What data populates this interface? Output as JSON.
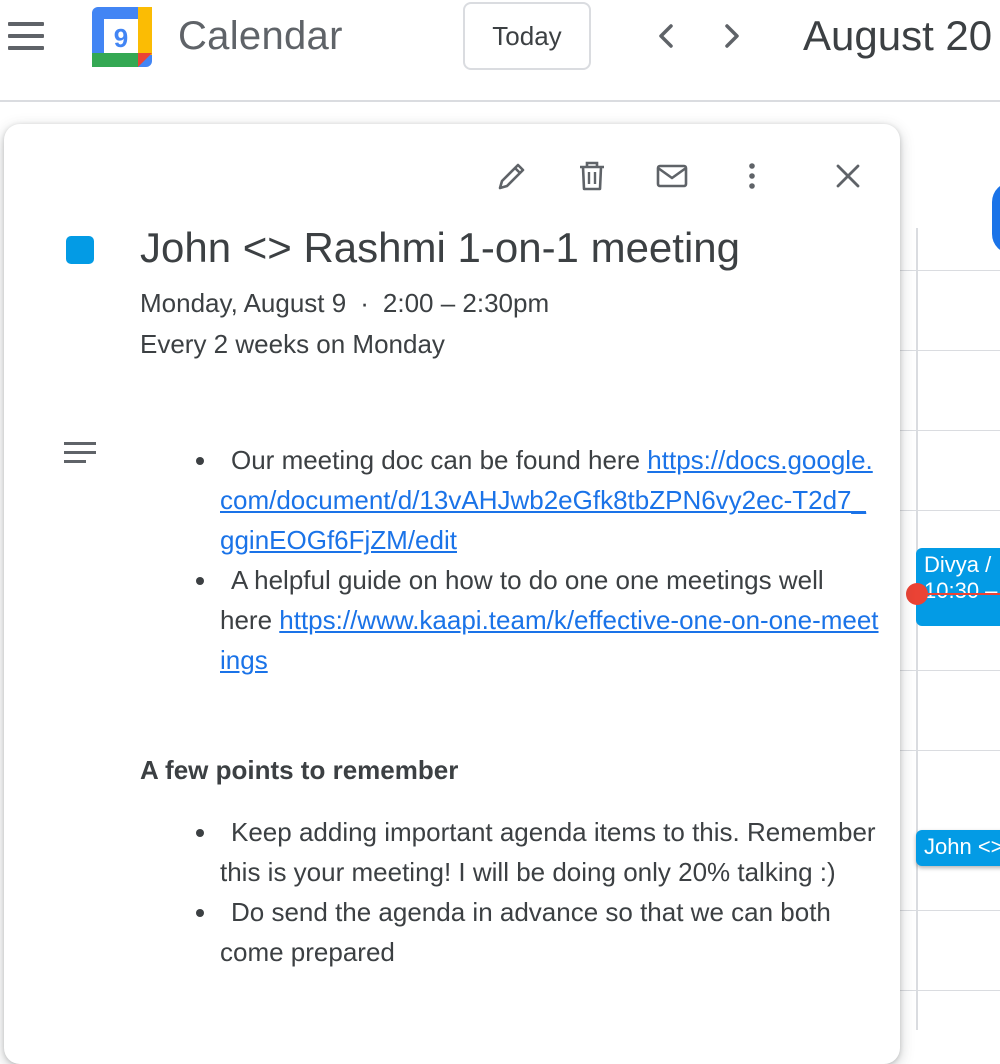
{
  "header": {
    "app_title": "Calendar",
    "logo_day": "9",
    "today_label": "Today",
    "month_title": "August 20"
  },
  "background_events": {
    "divya_title": "Divya /",
    "divya_time": "10:30 –",
    "john_title": "John <>"
  },
  "event": {
    "title": "John <> Rashmi 1-on-1 meeting",
    "date": "Monday, August 9",
    "separator": "·",
    "time": "2:00 – 2:30pm",
    "recurrence": "Every 2 weeks on Monday",
    "color": "#039be5",
    "description": {
      "item1_text": "Our meeting doc can be found here ",
      "item1_link": "https://docs.google.com/document/d/13vAHJwb2eGfk8tbZPN6vy2ec-T2d7_gginEOGf6FjZM/edit",
      "item2_text": "A helpful guide on how to do one one meetings well here ",
      "item2_link": "https://www.kaapi.team/k/effective-one-on-one-meetings",
      "heading": "A few points to remember",
      "point1": "Keep adding important agenda items to this. Remember this is your meeting! I will be doing only 20% talking :)",
      "point2": "Do send the agenda in advance so that we can both come prepared"
    }
  },
  "toolbar_icons": [
    "pencil-icon",
    "trash-icon",
    "mail-icon",
    "more-vert-icon",
    "close-icon"
  ]
}
